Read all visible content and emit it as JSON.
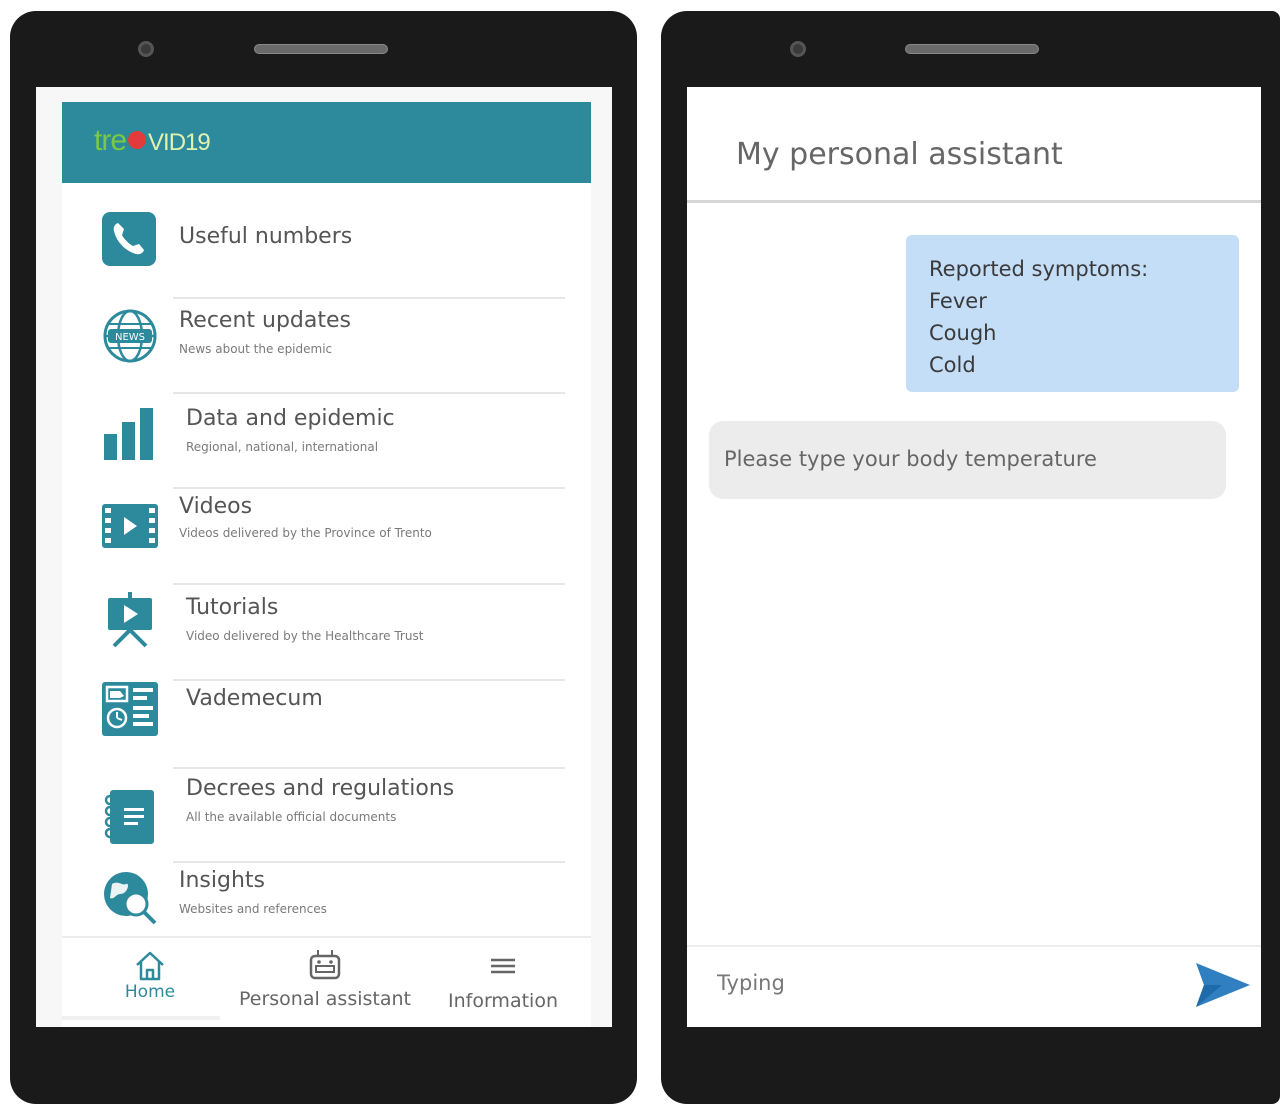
{
  "left_app": {
    "logo": {
      "part1": "tre",
      "part2": "VID19"
    },
    "menu": [
      {
        "title": "Useful numbers",
        "subtitle": "",
        "icon": "phone-icon"
      },
      {
        "title": "Recent updates",
        "subtitle": "News about the epidemic",
        "icon": "news-globe-icon"
      },
      {
        "title": "Data and epidemic",
        "subtitle": "Regional, national, international",
        "icon": "bar-chart-icon"
      },
      {
        "title": "Videos",
        "subtitle": "Videos delivered by the Province of Trento",
        "icon": "video-film-icon"
      },
      {
        "title": "Tutorials",
        "subtitle": "Video delivered by the Healthcare Trust",
        "icon": "presentation-board-icon"
      },
      {
        "title": "Vademecum",
        "subtitle": "",
        "icon": "vademecum-icon"
      },
      {
        "title": "Decrees and regulations",
        "subtitle": "All the available official documents",
        "icon": "notebook-icon"
      },
      {
        "title": "Insights",
        "subtitle": "Websites and references",
        "icon": "globe-search-icon"
      }
    ],
    "nav": {
      "home": "Home",
      "assistant": "Personal assistant",
      "information": "Information"
    },
    "colors": {
      "header": "#2d8a9d",
      "accent": "#2d8a9d"
    }
  },
  "right_app": {
    "title": "My personal assistant",
    "user_message": [
      "Reported symptoms:",
      "Fever",
      "Cough",
      "Cold"
    ],
    "bot_message": "Please type your body temperature",
    "input": {
      "placeholder": "Typing",
      "value": ""
    },
    "colors": {
      "user_bubble": "#c4def8",
      "bot_bubble": "#ececec",
      "send": "#2f7fc1"
    }
  }
}
